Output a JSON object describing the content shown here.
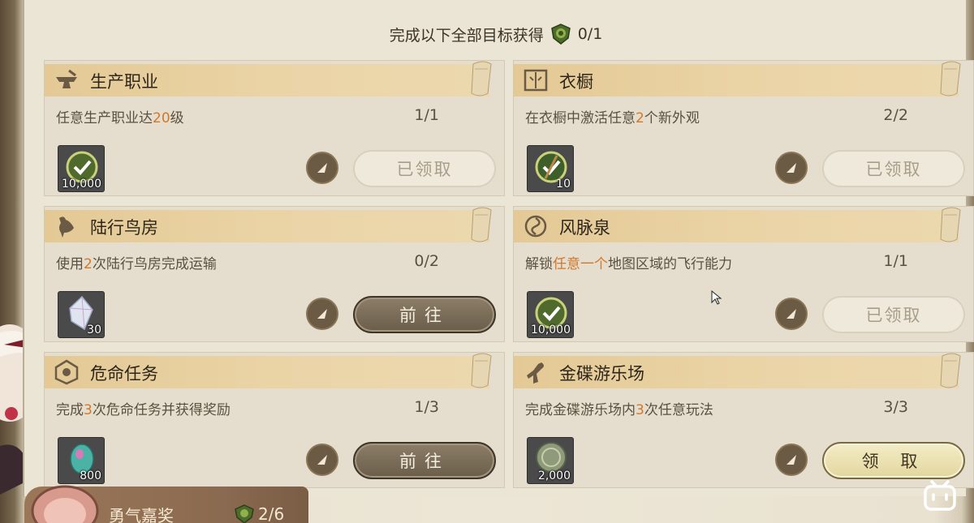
{
  "header": {
    "label": "完成以下全部目标获得",
    "count": "0/1",
    "medal_icon": "green-medal-icon"
  },
  "cards": [
    {
      "title": "生产职业",
      "icon": "anvil-icon",
      "desc_parts": [
        "任意生产职业达",
        "20",
        "级"
      ],
      "progress": "1/1",
      "reward_icon": "green-check-token-icon",
      "reward_qty": "10,000",
      "action": "已领取",
      "action_type": "claimed"
    },
    {
      "title": "衣橱",
      "icon": "wardrobe-icon",
      "desc_parts": [
        "在衣橱中激活任意",
        "2",
        "个新外观"
      ],
      "progress": "2/2",
      "reward_icon": "green-check-token-icon",
      "reward_qty": "10",
      "action": "已领取",
      "action_type": "claimed"
    },
    {
      "title": "陆行鸟房",
      "icon": "chocobo-icon",
      "desc_parts": [
        "使用",
        "2",
        "次陆行鸟房完成运输"
      ],
      "progress": "0/2",
      "reward_icon": "crystal-icon",
      "reward_qty": "30",
      "action": "前往",
      "action_type": "goto"
    },
    {
      "title": "风脉泉",
      "icon": "aether-current-icon",
      "desc_parts": [
        "解锁",
        "任意一个",
        "地图区域的飞行能力"
      ],
      "progress": "1/1",
      "reward_icon": "green-check-token-icon",
      "reward_qty": "10,000",
      "action": "已领取",
      "action_type": "claimed"
    },
    {
      "title": "危命任务",
      "icon": "fate-icon",
      "desc_parts": [
        "完成",
        "3",
        "次危命任务并获得奖励"
      ],
      "progress": "1/3",
      "reward_icon": "gem-icon",
      "reward_qty": "800",
      "action": "前往",
      "action_type": "goto"
    },
    {
      "title": "金碟游乐场",
      "icon": "gold-saucer-icon",
      "desc_parts": [
        "完成金碟游乐场内",
        "3",
        "次任意玩法"
      ],
      "progress": "3/3",
      "reward_icon": "mgp-coin-icon",
      "reward_qty": "2,000",
      "action": "领 取",
      "action_type": "claim"
    }
  ],
  "footer": {
    "label": "勇气嘉奖",
    "count": "2/6"
  },
  "colors": {
    "highlight": "#d0782d",
    "band": "#e4c995",
    "page": "#ebe5d5"
  }
}
